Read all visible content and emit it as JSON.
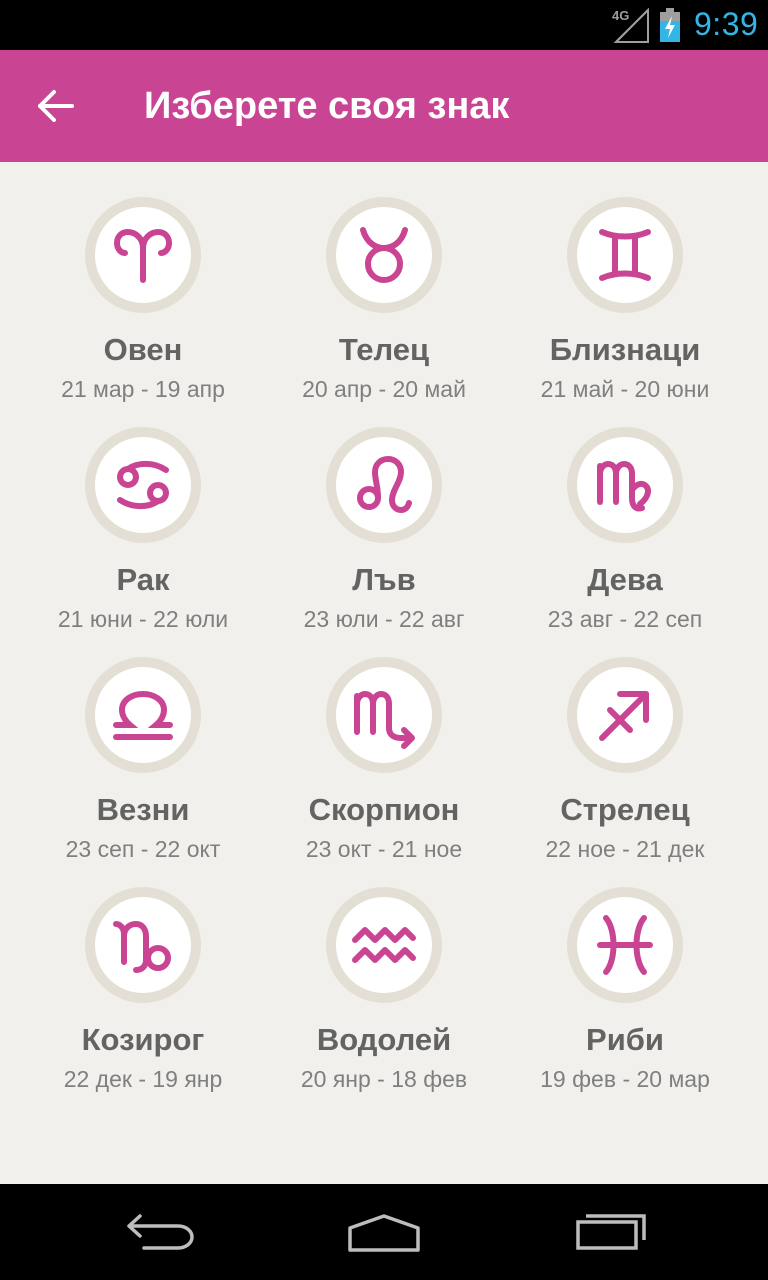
{
  "status_bar": {
    "network": "4G",
    "time": "9:39"
  },
  "header": {
    "title": "Изберете своя знак"
  },
  "signs": [
    {
      "name": "Овен",
      "dates": "21 мар - 19 апр",
      "icon": "aries-icon"
    },
    {
      "name": "Телец",
      "dates": "20 апр - 20 май",
      "icon": "taurus-icon"
    },
    {
      "name": "Близнаци",
      "dates": "21 май - 20 юни",
      "icon": "gemini-icon"
    },
    {
      "name": "Рак",
      "dates": "21 юни - 22 юли",
      "icon": "cancer-icon"
    },
    {
      "name": "Лъв",
      "dates": "23 юли - 22 авг",
      "icon": "leo-icon"
    },
    {
      "name": "Дева",
      "dates": "23 авг - 22 сеп",
      "icon": "virgo-icon"
    },
    {
      "name": "Везни",
      "dates": "23 сеп - 22 окт",
      "icon": "libra-icon"
    },
    {
      "name": "Скорпион",
      "dates": "23 окт - 21 ное",
      "icon": "scorpio-icon"
    },
    {
      "name": "Стрелец",
      "dates": "22 ное - 21 дек",
      "icon": "sagittarius-icon"
    },
    {
      "name": "Козирог",
      "dates": "22 дек - 19 янр",
      "icon": "capricorn-icon"
    },
    {
      "name": "Водолей",
      "dates": "20 янр - 18 фев",
      "icon": "aquarius-icon"
    },
    {
      "name": "Риби",
      "dates": "19 фев - 20 мар",
      "icon": "pisces-icon"
    }
  ],
  "colors": {
    "accent": "#c94594",
    "background": "#f1f0ec",
    "circle_ring": "#e3dfd4",
    "clock": "#33b5e5"
  }
}
